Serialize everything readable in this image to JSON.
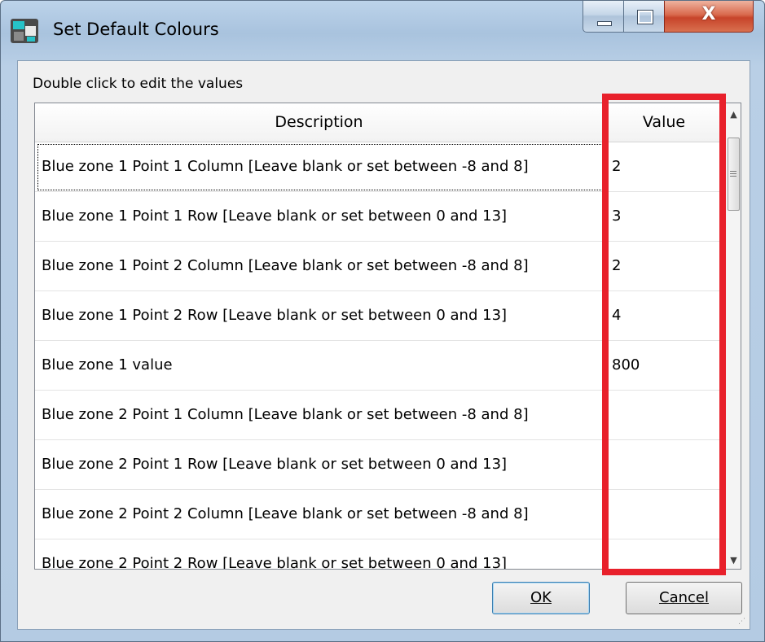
{
  "window": {
    "title": "Set Default Colours",
    "close_glyph": "X"
  },
  "hint": "Double click to edit the values",
  "table": {
    "columns": [
      "Description",
      "Value"
    ],
    "rows": [
      {
        "description": "Blue zone 1 Point 1 Column [Leave blank or set between -8 and 8]",
        "value": "2"
      },
      {
        "description": "Blue zone 1 Point 1 Row [Leave blank or set between 0 and 13]",
        "value": "3"
      },
      {
        "description": "Blue zone 1 Point 2 Column [Leave blank or set between -8 and 8]",
        "value": "2"
      },
      {
        "description": "Blue zone 1 Point 2 Row [Leave blank or set between 0 and 13]",
        "value": "4"
      },
      {
        "description": "Blue zone 1 value",
        "value": "800"
      },
      {
        "description": "Blue zone 2 Point 1 Column [Leave blank or set between -8 and 8]",
        "value": ""
      },
      {
        "description": "Blue zone 2 Point 1 Row [Leave blank or set between 0 and 13]",
        "value": ""
      },
      {
        "description": "Blue zone 2 Point 2 Column [Leave blank or set between -8 and 8]",
        "value": ""
      },
      {
        "description": "Blue zone 2 Point 2 Row [Leave blank or set between 0 and 13]",
        "value": ""
      }
    ]
  },
  "buttons": {
    "ok": "OK",
    "cancel": "Cancel"
  },
  "icons": {
    "app": "app-icon",
    "minimize": "minimize-icon",
    "maximize": "maximize-icon",
    "close": "close-icon",
    "scroll_up": "scroll-up-arrow-icon",
    "scroll_down": "scroll-down-arrow-icon"
  },
  "colors": {
    "highlight": "#e8202b",
    "close_button": "#c7442a",
    "title_bar": "#bcd3ea"
  }
}
